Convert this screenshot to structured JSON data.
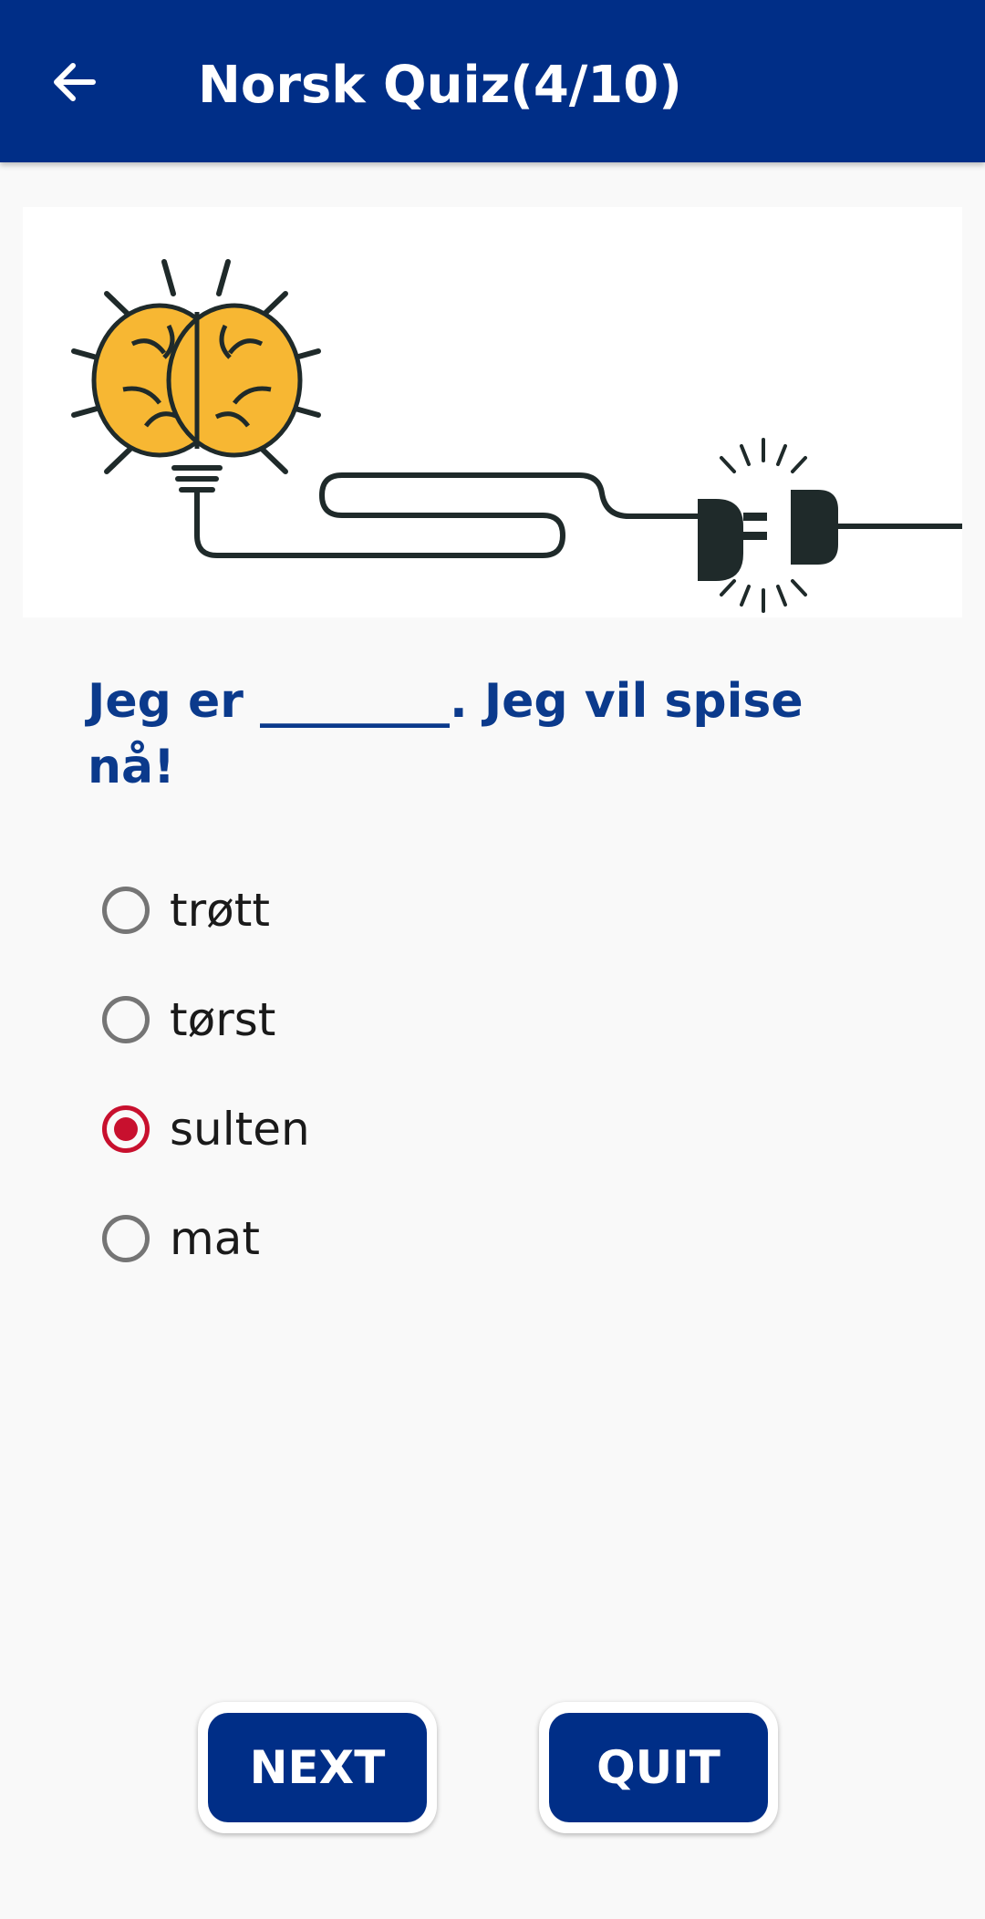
{
  "app_bar": {
    "title": "Norsk Quiz(4/10)",
    "back_icon": "arrow-left-icon",
    "color": "#002e87"
  },
  "hero_image": {
    "description_icon": "brain-lightbulb-plug-icon",
    "bulb_color": "#f7b733"
  },
  "question": {
    "text": "Jeg er ________. Jeg vil spise nå!",
    "color": "#0b3a8c"
  },
  "options": [
    {
      "label": "trøtt",
      "selected": false
    },
    {
      "label": "tørst",
      "selected": false
    },
    {
      "label": "sulten",
      "selected": true
    },
    {
      "label": "mat",
      "selected": false
    }
  ],
  "selected_color": "#c8102e",
  "buttons": {
    "next_label": "NEXT",
    "quit_label": "QUIT"
  }
}
